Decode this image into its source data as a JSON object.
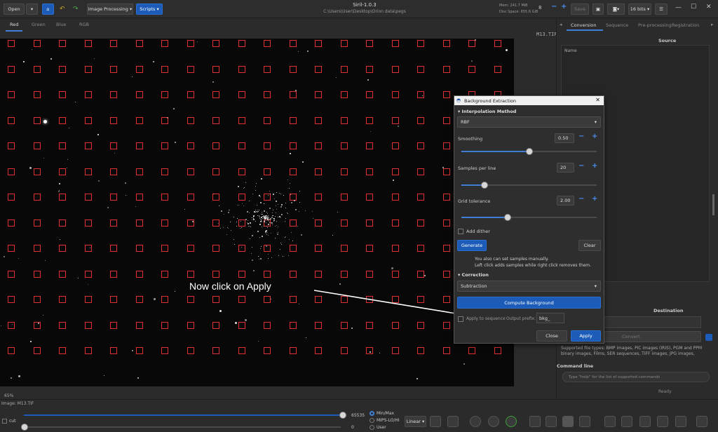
{
  "toolbar": {
    "open_label": "Open",
    "image_processing_label": "Image Processing",
    "scripts_label": "Scripts",
    "save_label": "Save",
    "bits_label": "16 bits",
    "thread_count": "8",
    "app_title": "Siril-1.0.3",
    "path": "C:\\Users\\User\\Desktop\\Orion data\\pegs",
    "mem": "Mem: 241.7 MiB",
    "disk": "Disc Space: 655.6 GiB"
  },
  "channel_tabs": [
    "Red",
    "Green",
    "Blue",
    "RGB"
  ],
  "viewer": {
    "filename_overlay": "M13.TIF",
    "zoom": "65%",
    "image_label": "Image: M13.TIF"
  },
  "right_panel": {
    "tabs": [
      "Conversion",
      "Sequence",
      "Pre-processing",
      "Registration"
    ],
    "source_header": "Source",
    "name_col": "Name",
    "destination_header": "Destination",
    "convert_label": "Convert",
    "supported_text": "Supported file types: BMP images, PiC images (IRIS), PGM and PPM binary images, Films, SER sequences, TIFF images, JPG images,",
    "command_line_label": "Command line",
    "command_placeholder": "Type \"help\" for the list of supported commands",
    "ready": "Ready"
  },
  "dialog": {
    "title": "Background Extraction",
    "interp_section": "Interpolation Method",
    "interp_value": "RBF",
    "smoothing_label": "Smoothing",
    "smoothing_value": "0.50",
    "samples_label": "Samples per line",
    "samples_value": "20",
    "grid_label": "Grid tolerance",
    "grid_value": "2.00",
    "dither_label": "Add dither",
    "generate_label": "Generate",
    "clear_label": "Clear",
    "info_line1": "You also can set samples manually.",
    "info_line2": "Left click adds samples while right click removes them.",
    "correction_section": "Correction",
    "correction_value": "Subtraction",
    "compute_label": "Compute Background",
    "apply_seq_label": "Apply to sequence",
    "output_prefix_label": "Output prefix:",
    "output_prefix_value": "bkg_",
    "close_label": "Close",
    "apply_label": "Apply",
    "smoothing_fraction": 0.5,
    "samples_fraction": 0.17,
    "grid_fraction": 0.34
  },
  "bottom": {
    "cut_label": "cut",
    "max_value": "65535",
    "min_value": "0",
    "mode_minmax": "Min/Max",
    "mode_mips": "MIPS-LO/HI",
    "mode_user": "User",
    "scale": "Linear"
  },
  "annotation": "Now click on Apply"
}
